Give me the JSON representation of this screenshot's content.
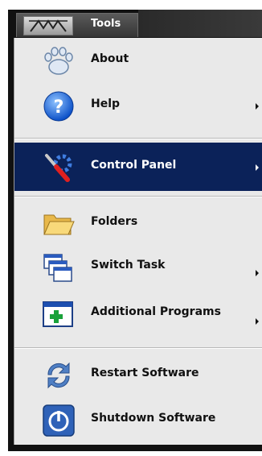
{
  "tab": {
    "label": "Tools",
    "logo_icon": "avolites-logo-icon"
  },
  "menu": {
    "items": [
      {
        "label": "About",
        "icon": "paw-icon",
        "has_submenu": false
      },
      {
        "label": "Help",
        "icon": "help-icon",
        "has_submenu": true
      },
      {
        "label": "Control Panel",
        "icon": "tools-gear-icon",
        "has_submenu": true,
        "selected": true
      },
      {
        "label": "Folders",
        "icon": "folder-icon",
        "has_submenu": false
      },
      {
        "label": "Switch Task",
        "icon": "windows-icon",
        "has_submenu": true
      },
      {
        "label": "Additional Programs",
        "icon": "add-program-icon",
        "has_submenu": true
      },
      {
        "label": "Restart Software",
        "icon": "restart-icon",
        "has_submenu": false
      },
      {
        "label": "Shutdown Software",
        "icon": "power-icon",
        "has_submenu": false
      }
    ]
  },
  "colors": {
    "selected_bg": "#0b2259",
    "menu_bg": "#e9e9e9",
    "frame": "#111111"
  }
}
